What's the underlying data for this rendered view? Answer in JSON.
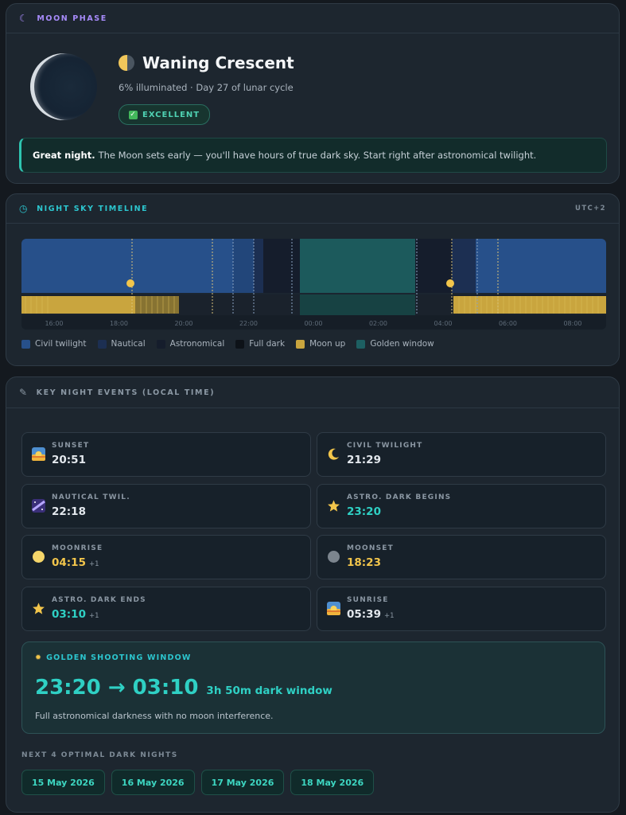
{
  "moon": {
    "header": "MOON PHASE",
    "phase_name": "Waning Crescent",
    "subtitle": "6% illuminated · Day 27 of lunar cycle",
    "rating": "EXCELLENT",
    "tip_bold": "Great night.",
    "tip_text": "The Moon sets early — you'll have hours of true dark sky. Start right after astronomical twilight."
  },
  "timeline": {
    "header": "NIGHT SKY TIMELINE",
    "timezone": "UTC+2",
    "ticks": [
      "16:00",
      "18:00",
      "20:00",
      "22:00",
      "00:00",
      "02:00",
      "04:00",
      "06:00",
      "08:00"
    ],
    "legend": [
      {
        "label": "Civil twilight",
        "color": "#27508a"
      },
      {
        "label": "Nautical",
        "color": "#1c2f52"
      },
      {
        "label": "Astronomical",
        "color": "#151d2c"
      },
      {
        "label": "Full dark",
        "color": "#0d1218"
      },
      {
        "label": "Moon up",
        "color": "#c9a53e"
      },
      {
        "label": "Golden window",
        "color": "#1d5f62"
      }
    ]
  },
  "events": {
    "header": "KEY NIGHT EVENTS (LOCAL TIME)",
    "items": [
      {
        "label": "SUNSET",
        "time": "20:51",
        "plus": "",
        "icon": "sunset-icon",
        "style": "plain"
      },
      {
        "label": "CIVIL TWILIGHT",
        "time": "21:29",
        "plus": "",
        "icon": "crescent-moon-icon",
        "style": "plain"
      },
      {
        "label": "NAUTICAL TWIL.",
        "time": "22:18",
        "plus": "",
        "icon": "milky-way-icon",
        "style": "plain"
      },
      {
        "label": "ASTRO. DARK BEGINS",
        "time": "23:20",
        "plus": "",
        "icon": "star-icon",
        "style": "teal"
      },
      {
        "label": "MOONRISE",
        "time": "04:15",
        "plus": "+1",
        "icon": "moonrise-icon",
        "style": "gold"
      },
      {
        "label": "MOONSET",
        "time": "18:23",
        "plus": "",
        "icon": "moonset-icon",
        "style": "gold"
      },
      {
        "label": "ASTRO. DARK ENDS",
        "time": "03:10",
        "plus": "+1",
        "icon": "star-icon",
        "style": "teal"
      },
      {
        "label": "SUNRISE",
        "time": "05:39",
        "plus": "+1",
        "icon": "sunrise-icon",
        "style": "plain"
      }
    ],
    "golden": {
      "header": "GOLDEN SHOOTING WINDOW",
      "range": "23:20 → 03:10",
      "duration": "3h 50m dark window",
      "desc": "Full astronomical darkness with no moon interference."
    },
    "next_label": "NEXT 4 OPTIMAL DARK NIGHTS",
    "next_nights": [
      "15 May 2026",
      "16 May 2026",
      "17 May 2026",
      "18 May 2026"
    ]
  }
}
